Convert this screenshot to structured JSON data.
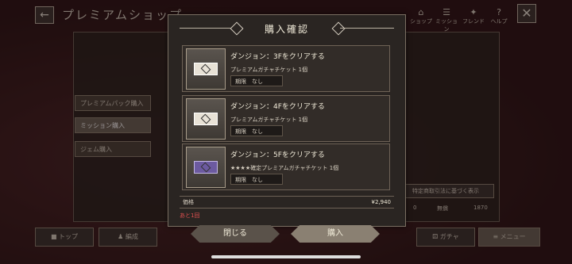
{
  "header": {
    "back_label": "←",
    "title": "プレミアムショップ",
    "close_label": "✕",
    "gem_count": "1870"
  },
  "topnav": [
    {
      "label": "ショップ",
      "icon": "shop-icon"
    },
    {
      "label": "ミッション",
      "icon": "mission-icon"
    },
    {
      "label": "フレンド",
      "icon": "friend-icon"
    },
    {
      "label": "ヘルプ",
      "icon": "help-icon"
    }
  ],
  "sidebar": {
    "items": [
      {
        "label": "プレミアムパック購入"
      },
      {
        "label": "ミッション購入"
      },
      {
        "label": "ジェム購入"
      }
    ]
  },
  "bottom": {
    "top": "トップ",
    "formation": "編成",
    "gacha": "ガチャ",
    "menu": "メニュー"
  },
  "background_right": {
    "legal_link": "特定商取引法に基づく表示",
    "paid_value": "0",
    "free_label": "無償",
    "free_value": "1870"
  },
  "modal": {
    "title": "購入確認",
    "items": [
      {
        "title": "ダンジョン：3Fをクリアする",
        "reward": "プレミアムガチャチケット 1個",
        "limit": "期限　なし"
      },
      {
        "title": "ダンジョン：4Fをクリアする",
        "reward": "プレミアムガチャチケット 1個",
        "limit": "期限　なし"
      },
      {
        "title": "ダンジョン：5Fをクリアする",
        "reward": "★★★★確定プレミアムガチャチケット 1個",
        "limit": "期限　なし"
      }
    ],
    "price_label": "価格",
    "price_value": "¥2,940",
    "remaining": "あと1回",
    "close_button": "閉じる",
    "buy_button": "購入"
  }
}
